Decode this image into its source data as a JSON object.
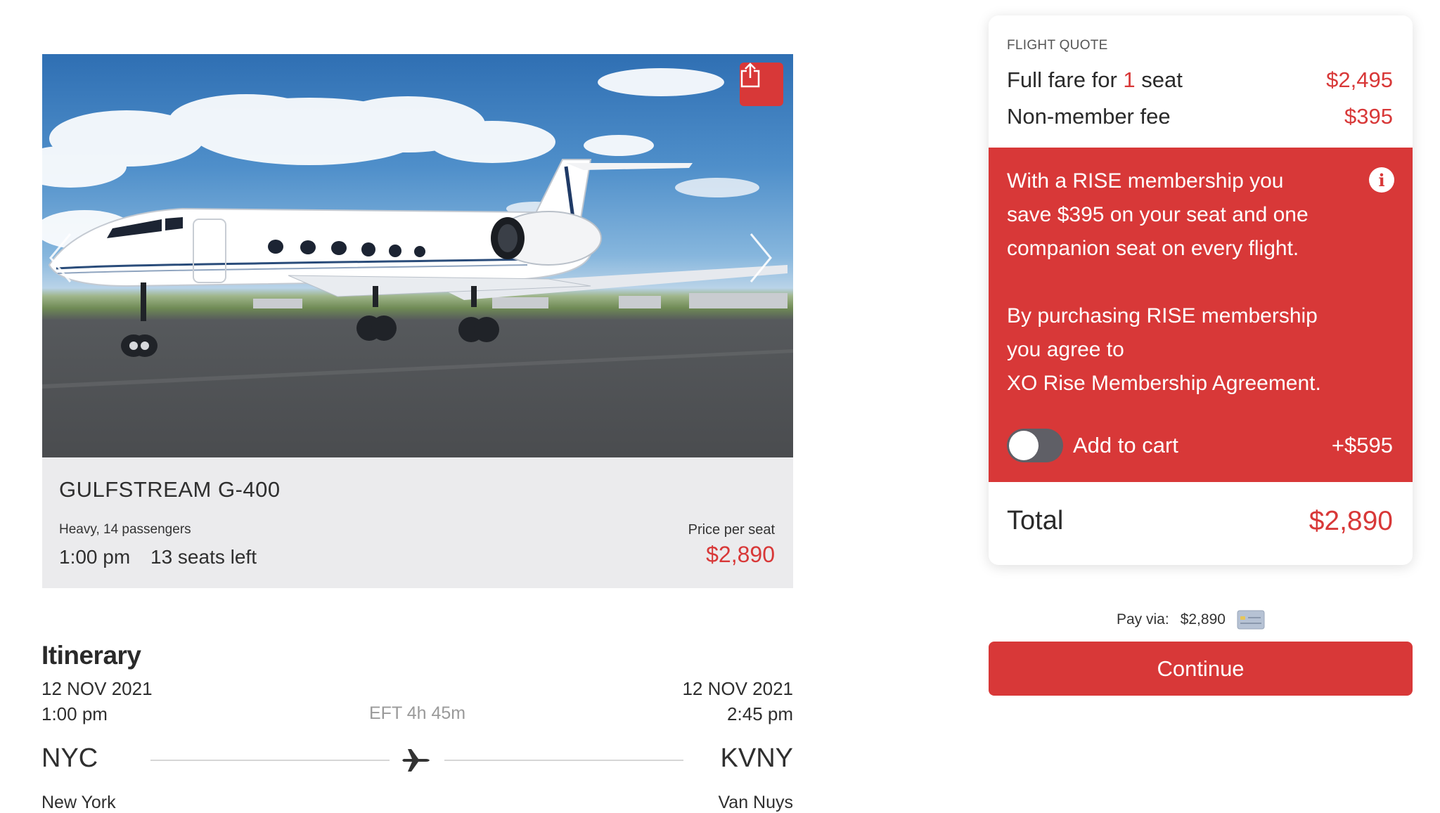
{
  "aircraft": {
    "name": "GULFSTREAM G-400",
    "class_passengers": "Heavy, 14 passengers",
    "departure_time": "1:00 pm",
    "seats_left": "13 seats left",
    "price_label": "Price per seat",
    "price_value": "$2,890",
    "icons": {
      "share": "share-icon",
      "previous": "chevron-left-icon",
      "next": "chevron-right-icon"
    }
  },
  "itinerary": {
    "title": "Itinerary",
    "from": {
      "date": "12 NOV 2021",
      "time": "1:00 pm",
      "code": "NYC",
      "city": "New York"
    },
    "to": {
      "date": "12 NOV 2021",
      "time": "2:45 pm",
      "code": "KVNY",
      "city": "Van Nuys"
    },
    "eft": "EFT 4h 45m",
    "route_icon": "airplane-icon"
  },
  "quote": {
    "label": "FLIGHT QUOTE",
    "fare_prefix": "Full fare for ",
    "fare_seats": "1",
    "fare_suffix": " seat",
    "fare_value": "$2,495",
    "fee_label": "Non-member fee",
    "fee_value": "$395",
    "rise": {
      "line1": "With a RISE membership you",
      "line2": "save $395 on your seat and one",
      "line3": "companion seat on every flight.",
      "line4": "By purchasing RISE membership",
      "line5": "you agree to",
      "line6": "XO Rise Membership Agreement.",
      "info_icon": "i",
      "add_label": "Add to cart",
      "add_price": "+$595",
      "toggle_on": false
    },
    "total_label": "Total",
    "total_value": "$2,890"
  },
  "payment": {
    "label": "Pay via:",
    "amount": "$2,890",
    "icon": "credit-card-icon"
  },
  "continue_label": "Continue",
  "colors": {
    "accent": "#d83838",
    "panel": "#ebebed",
    "text": "#2a2a2a"
  }
}
